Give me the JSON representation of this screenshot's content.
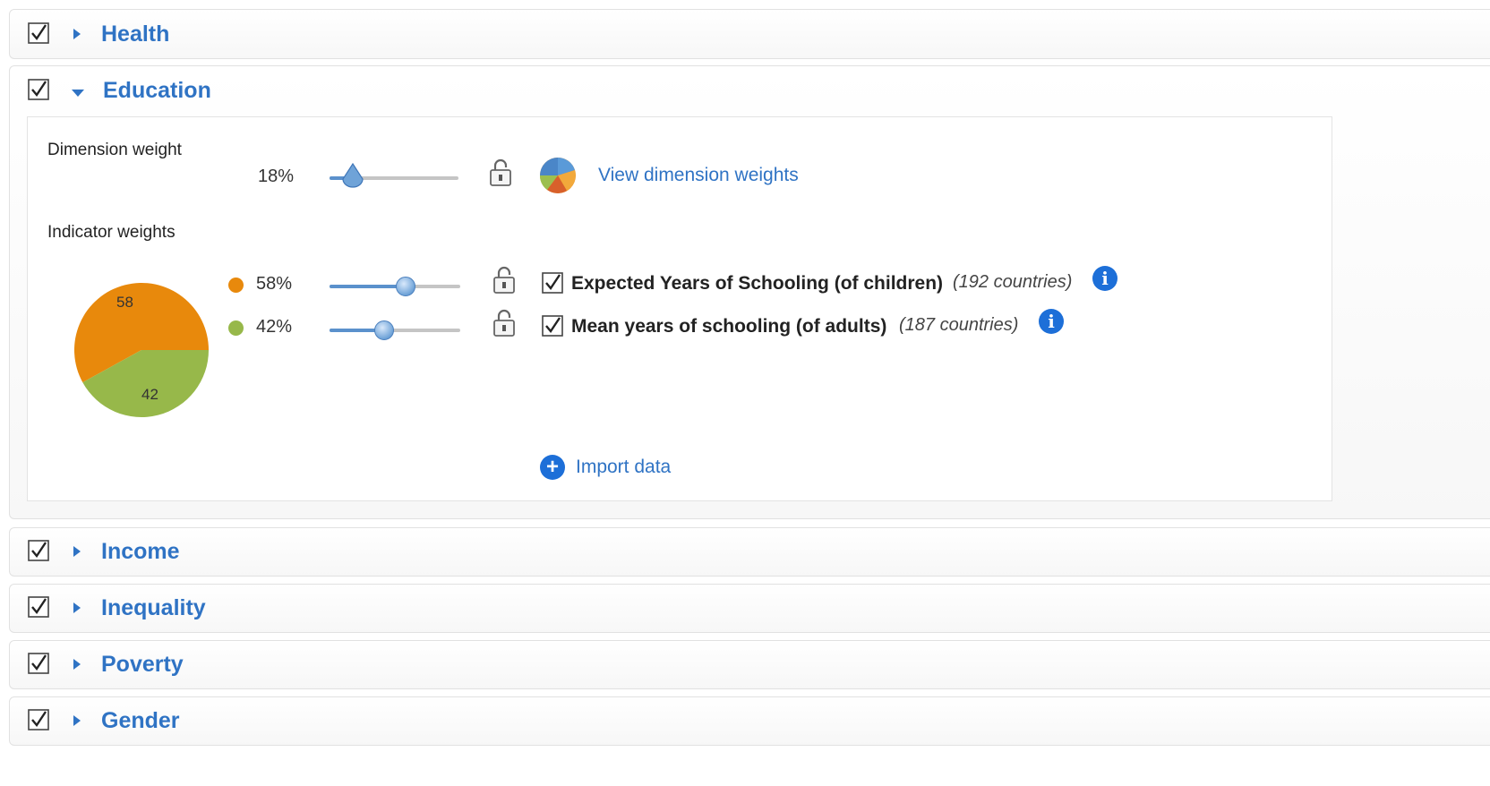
{
  "dimensions": [
    {
      "title": "Health",
      "checked": true,
      "expanded": false
    },
    {
      "title": "Education",
      "checked": true,
      "expanded": true
    },
    {
      "title": "Income",
      "checked": true,
      "expanded": false
    },
    {
      "title": "Inequality",
      "checked": true,
      "expanded": false
    },
    {
      "title": "Poverty",
      "checked": true,
      "expanded": false
    },
    {
      "title": "Gender",
      "checked": true,
      "expanded": false
    }
  ],
  "education": {
    "dimension_weight_label": "Dimension weight",
    "dimension_weight_value": "18%",
    "dimension_weight_fraction": 0.18,
    "view_weights_link": "View dimension weights",
    "indicator_weights_label": "Indicator weights",
    "indicators": [
      {
        "weight": "58%",
        "fraction": 0.58,
        "name": "Expected Years of Schooling (of children)",
        "countries": "(192 countries)",
        "color": "#e8890c",
        "checked": true
      },
      {
        "weight": "42%",
        "fraction": 0.42,
        "name": "Mean years of schooling (of adults)",
        "countries": "(187 countries)",
        "color": "#97b84a",
        "checked": true
      }
    ],
    "pie": {
      "labels": [
        "58",
        "42"
      ],
      "values": [
        58,
        42
      ],
      "colors": [
        "#e8890c",
        "#97b84a"
      ]
    },
    "import_link": "Import data"
  },
  "icons": {
    "checkbox": "checkbox-checked-icon",
    "expand": "caret-right-icon",
    "collapse": "caret-down-icon",
    "lock": "unlocked-padlock-icon",
    "info": "info-icon",
    "plus": "plus-circle-icon",
    "pie": "pie-chart-icon"
  },
  "colors": {
    "accent": "#2f73c4",
    "info": "#1d6fd8"
  }
}
